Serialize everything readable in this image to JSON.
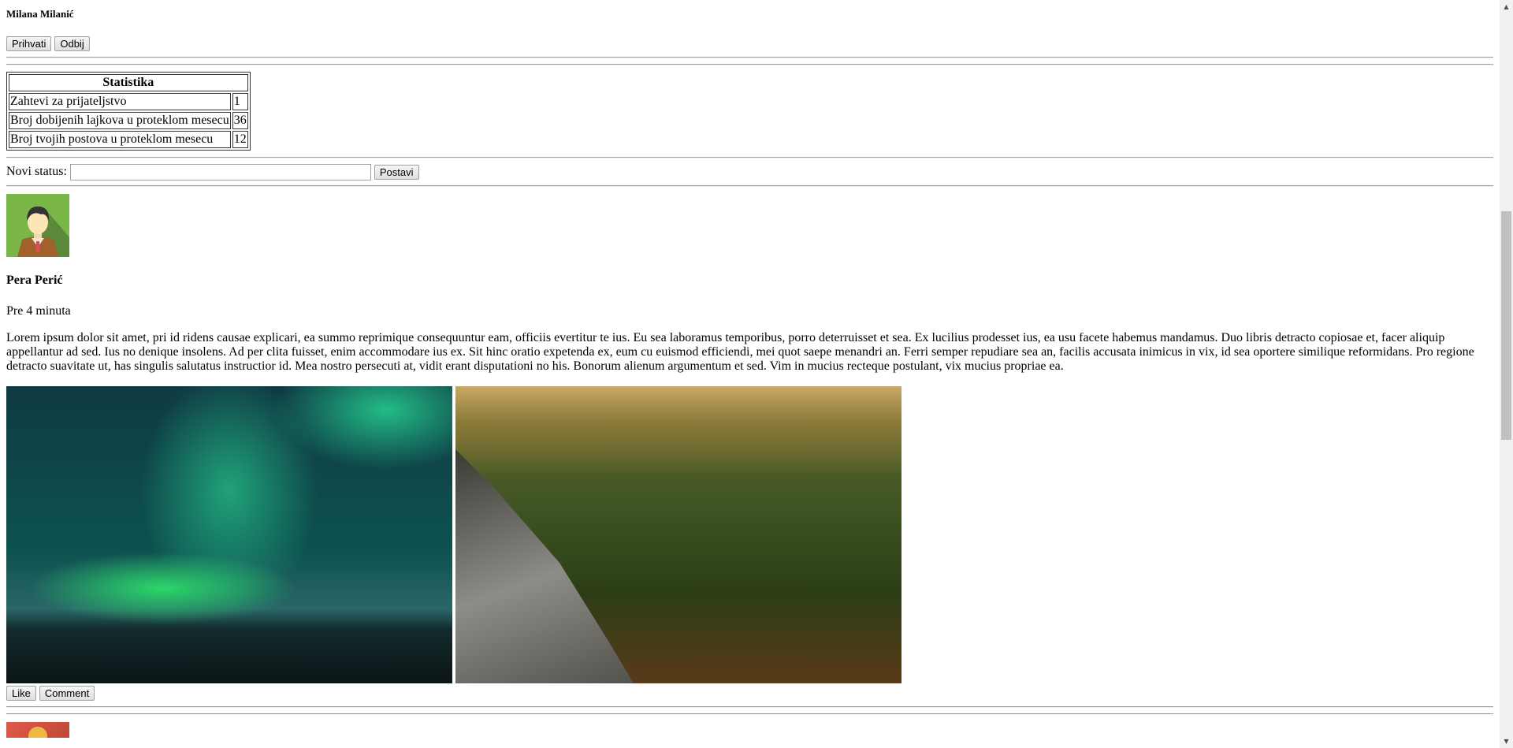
{
  "friend_request": {
    "name": "Milana Milanić",
    "accept_label": "Prihvati",
    "reject_label": "Odbij"
  },
  "stats": {
    "title": "Statistika",
    "rows": [
      {
        "label": "Zahtevi za prijateljstvo",
        "value": "1"
      },
      {
        "label": "Broj dobijenih lajkova u proteklom mesecu",
        "value": "36"
      },
      {
        "label": "Broj tvojih postova u proteklom mesecu",
        "value": "12"
      }
    ]
  },
  "status": {
    "label": "Novi status:",
    "value": "",
    "submit_label": "Postavi"
  },
  "post": {
    "author": "Pera Perić",
    "time": "Pre 4 minuta",
    "text": "Lorem ipsum dolor sit amet, pri id ridens causae explicari, ea summo reprimique consequuntur eam, officiis evertitur te ius. Eu sea laboramus temporibus, porro deterruisset et sea. Ex lucilius prodesset ius, ea usu facete habemus mandamus. Duo libris detracto copiosae et, facer aliquip appellantur ad sed. Ius no denique insolens. Ad per clita fuisset, enim accommodare ius ex. Sit hinc oratio expetenda ex, eum cu euismod efficiendi, mei quot saepe menandri an. Ferri semper repudiare sea an, facilis accusata inimicus in vix, id sea oportere similique reformidans. Pro regione detracto suavitate ut, has singulis salutatus instructior id. Mea nostro persecuti at, vidit erant disputationi no his. Bonorum alienum argumentum et sed. Vim in mucius recteque postulant, vix mucius propriae ea.",
    "like_label": "Like",
    "comment_label": "Comment"
  }
}
